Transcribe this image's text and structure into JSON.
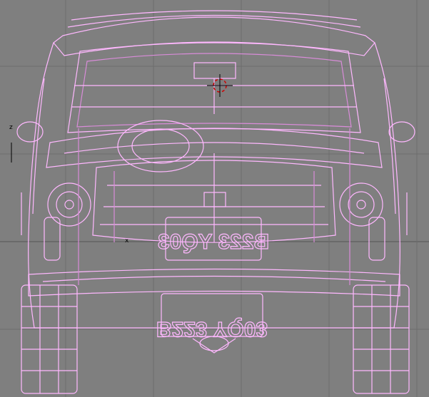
{
  "viewport": {
    "background": "#7f7f7f",
    "grid_color": "#6c6c6c",
    "wire_color": "#ffb8ff",
    "wire_dark": "#d98cd9",
    "cursor_color": "#d00000"
  },
  "axes": {
    "vertical_label": "z",
    "horizontal_label": "x"
  },
  "car": {
    "front_plate": "B223 YQ03",
    "rear_plate": "B223 YQ03"
  }
}
